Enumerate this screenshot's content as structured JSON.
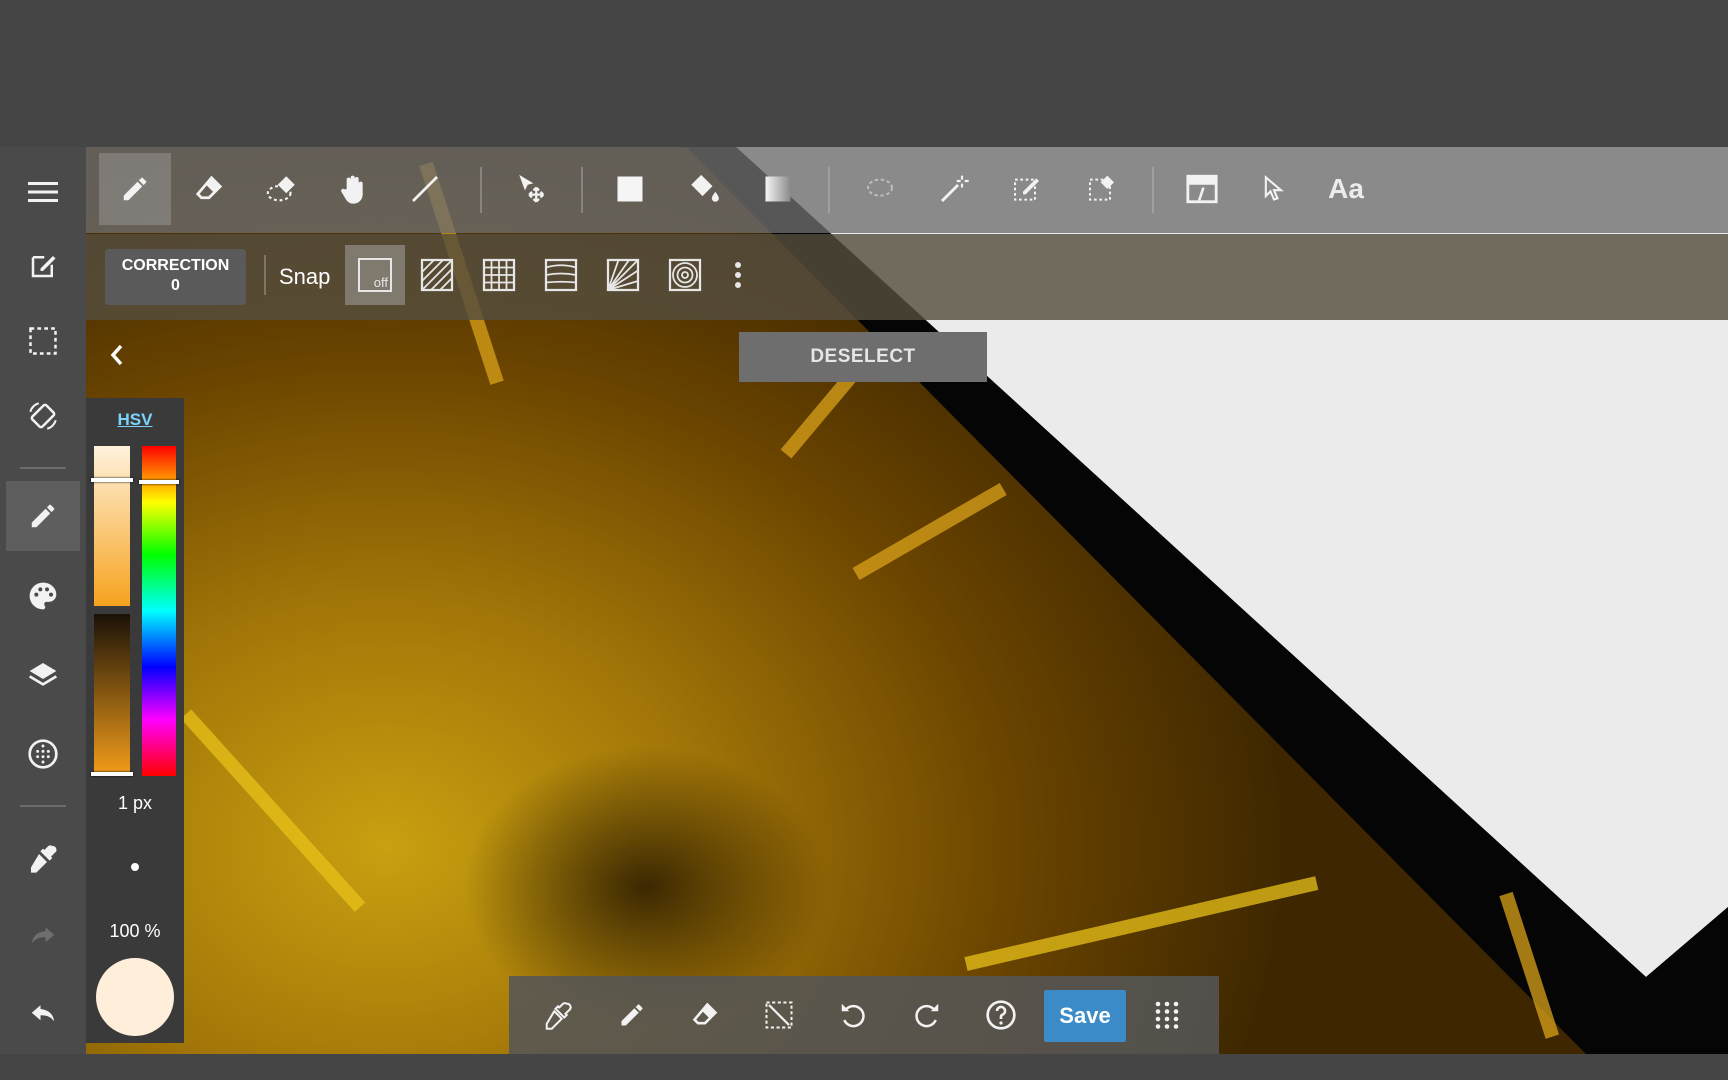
{
  "toolbar": {
    "tools": [
      {
        "name": "pen-tool",
        "icon": "pencil-icon",
        "active": true
      },
      {
        "name": "eraser-tool",
        "icon": "eraser-icon"
      },
      {
        "name": "selection-eraser-tool",
        "icon": "dotted-eraser-icon"
      },
      {
        "name": "hand-tool",
        "icon": "hand-icon"
      },
      {
        "name": "line-tool",
        "icon": "line-icon"
      },
      {
        "name": "move-tool",
        "icon": "move-icon"
      },
      {
        "name": "fill-rect-tool",
        "icon": "square-icon"
      },
      {
        "name": "bucket-tool",
        "icon": "paint-bucket-icon"
      },
      {
        "name": "gradient-tool",
        "icon": "gradient-icon"
      },
      {
        "name": "lasso-tool",
        "icon": "lasso-icon"
      },
      {
        "name": "magic-wand-tool",
        "icon": "magic-wand-icon"
      },
      {
        "name": "select-pen-tool",
        "icon": "select-pen-icon"
      },
      {
        "name": "select-eraser-tool",
        "icon": "select-eraser-icon"
      },
      {
        "name": "panel-divide-tool",
        "icon": "panel-icon"
      },
      {
        "name": "operation-tool",
        "icon": "cursor-icon"
      },
      {
        "name": "text-tool",
        "icon": "text-icon"
      }
    ],
    "text_tool_label": "Aa"
  },
  "subtoolbar": {
    "correction_label": "CORRECTION",
    "correction_value": "0",
    "snap_label": "Snap",
    "snap_off_label": "off"
  },
  "canvas": {
    "deselect_label": "DESELECT"
  },
  "color_panel": {
    "mode_label": "HSV",
    "pen_size": "1 px",
    "opacity": "100 %",
    "current_color": "#ffeeda"
  },
  "bottom_bar": {
    "save_label": "Save"
  },
  "colors": {
    "accent": "#3a8bc7",
    "hsv_link": "#7ad3ff"
  }
}
